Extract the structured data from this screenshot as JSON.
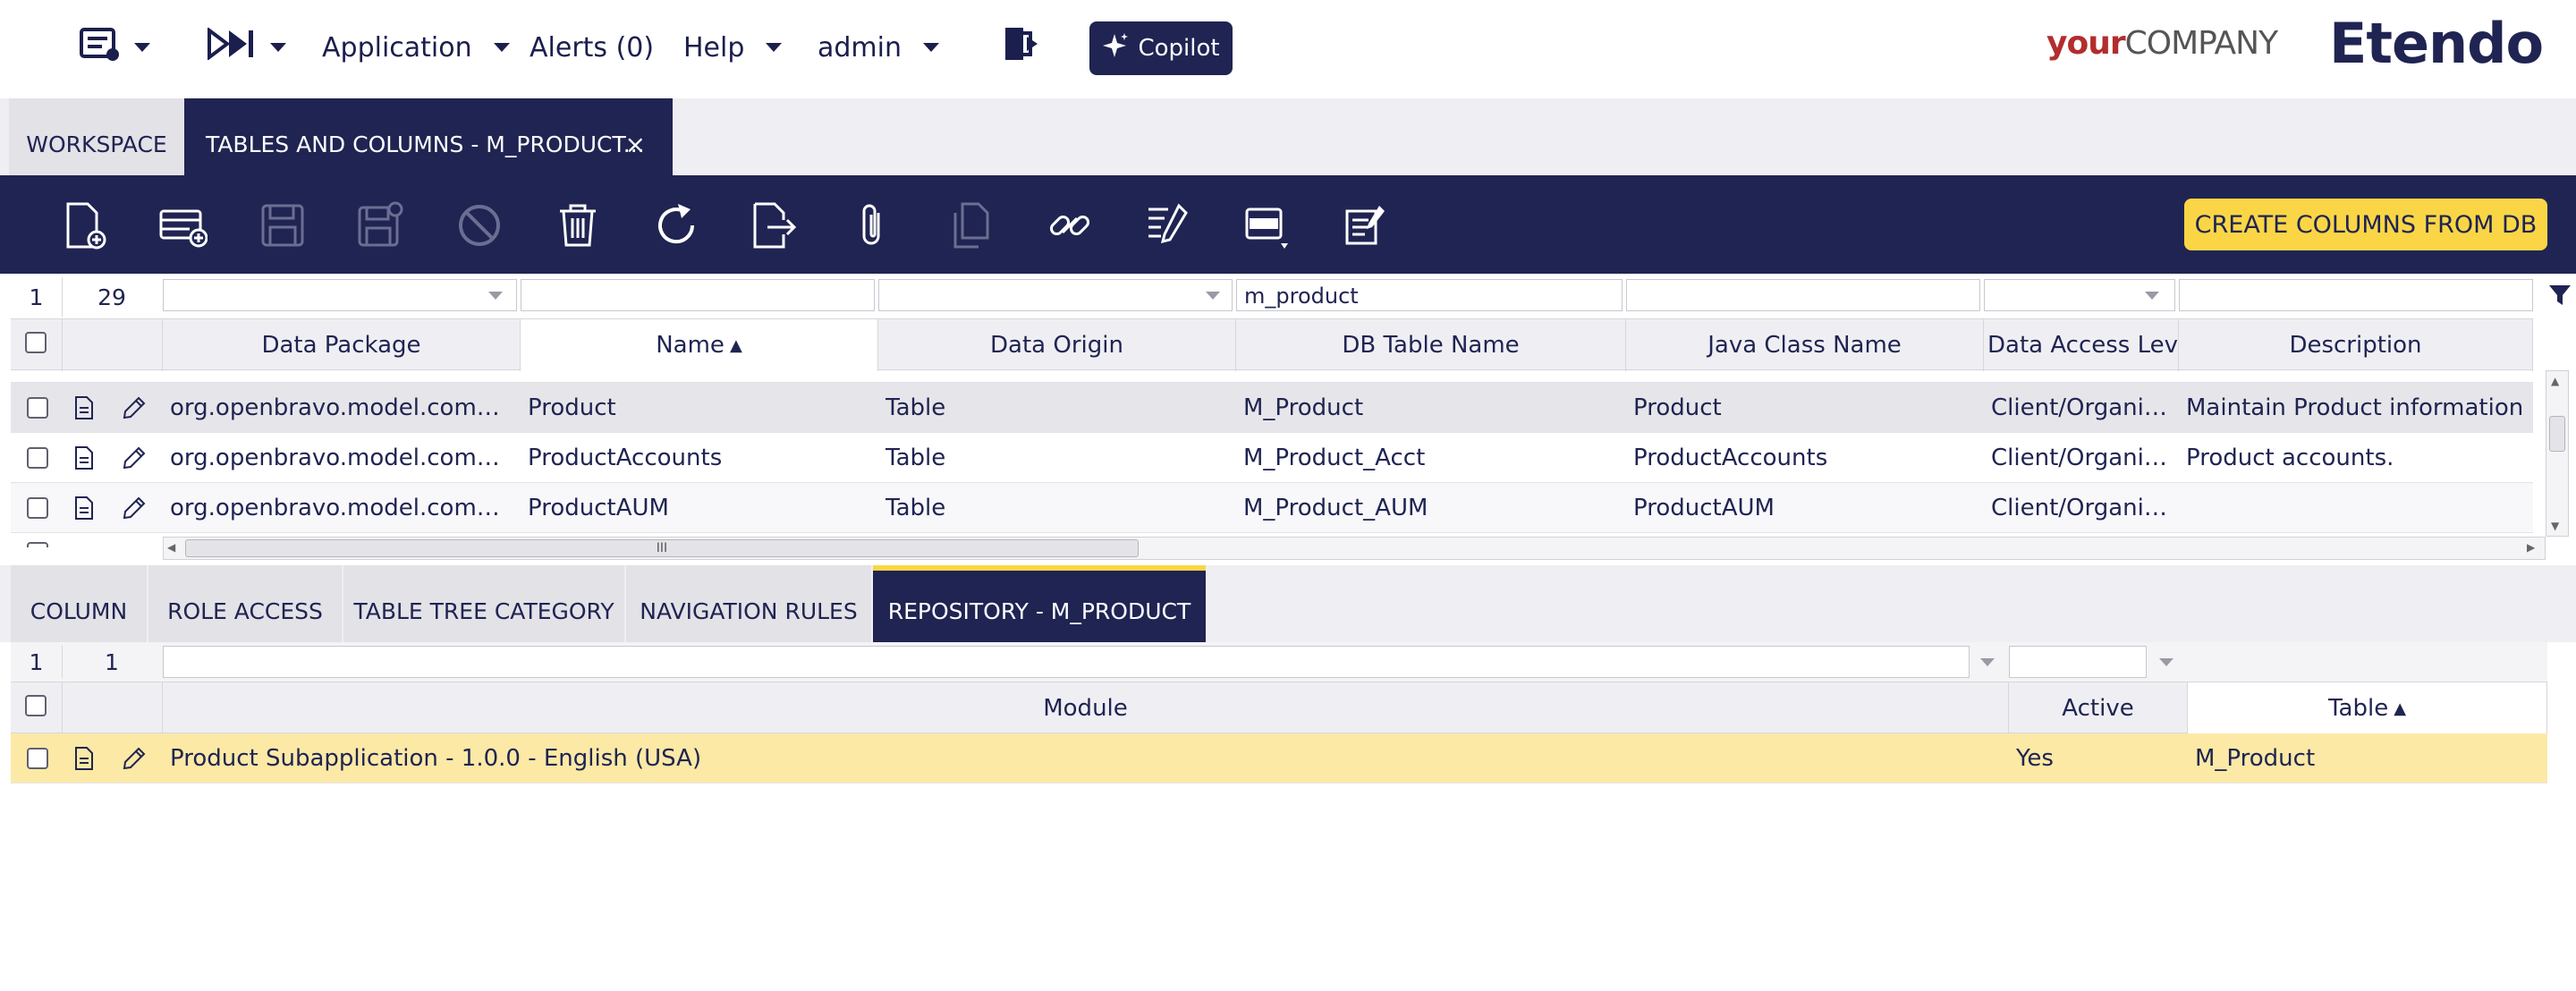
{
  "topbar": {
    "application": "Application",
    "alerts": "Alerts (0)",
    "help": "Help",
    "user": "admin",
    "copilot": "Copilot",
    "brand_your": "your",
    "brand_company": "COMPANY",
    "etendo": "Etendo"
  },
  "tabs": {
    "workspace": "WORKSPACE",
    "active": "TABLES AND COLUMNS - M_PRODUCT...",
    "close": "×"
  },
  "toolbar": {
    "icons": [
      "new-document-icon",
      "new-row-icon",
      "save-icon",
      "save-close-icon",
      "cancel-icon",
      "delete-icon",
      "refresh-icon",
      "export-icon",
      "attach-icon",
      "clone-icon",
      "link-icon",
      "audit-icon",
      "grid-toggle-icon",
      "notes-icon"
    ],
    "create_columns": "CREATE COLUMNS FROM DB"
  },
  "grid_top": {
    "selected": "1",
    "total": "29",
    "filter_db_table": "m_product",
    "columns": [
      "Data Package",
      "Name",
      "Data Origin",
      "DB Table Name",
      "Java Class Name",
      "Data Access Level",
      "Description"
    ],
    "rows": [
      [
        "org.openbravo.model.commo...",
        "Product",
        "Table",
        "M_Product",
        "Product",
        "Client/Organiz...",
        "Maintain Product information"
      ],
      [
        "org.openbravo.model.commo...",
        "ProductAccounts",
        "Table",
        "M_Product_Acct",
        "ProductAccounts",
        "Client/Organiz...",
        "Product accounts."
      ],
      [
        "org.openbravo.model.commo...",
        "ProductAUM",
        "Table",
        "M_Product_AUM",
        "ProductAUM",
        "Client/Organiz...",
        ""
      ]
    ],
    "scroll_glyph": "III"
  },
  "subtabs": [
    "COLUMN",
    "ROLE ACCESS",
    "TABLE TREE CATEGORY",
    "NAVIGATION RULES",
    "REPOSITORY - M_PRODUCT"
  ],
  "grid_bottom": {
    "selected": "1",
    "total": "1",
    "columns": [
      "Module",
      "Active",
      "Table"
    ],
    "rows": [
      [
        "Product Subapplication - 1.0.0 - English (USA)",
        "Yes",
        "M_Product"
      ]
    ]
  },
  "colors": {
    "navy": "#202452",
    "yellow": "#fad646",
    "selected_row": "#fbe9a5",
    "hover_row": "#e6e6ea"
  }
}
